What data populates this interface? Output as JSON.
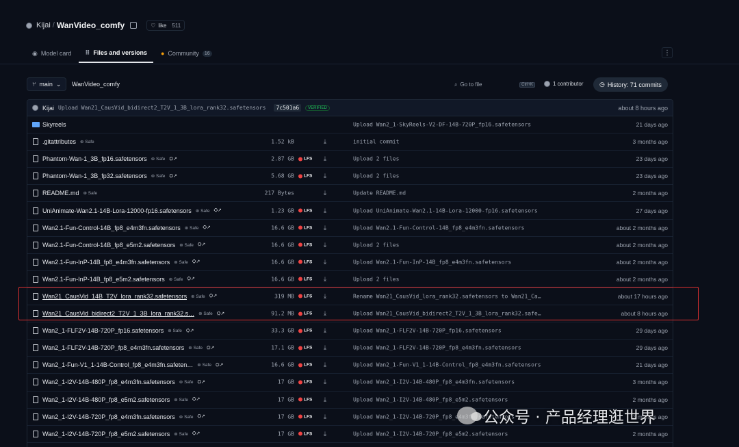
{
  "repo": {
    "owner": "Kijai",
    "separator": "/",
    "name": "WanVideo_comfy",
    "like_label": "like",
    "like_count": "511"
  },
  "tabs": [
    {
      "label": "Model card",
      "icon": "model-card-icon"
    },
    {
      "label": "Files and versions",
      "icon": "files-icon"
    },
    {
      "label": "Community",
      "icon": "community-icon",
      "count": "16"
    }
  ],
  "more_label": "⋮",
  "toolbar": {
    "branch": "main",
    "breadcrumb": "WanVideo_comfy",
    "goto_placeholder": "Go to file",
    "goto_kbd": "Ctrl+K",
    "contributors": "1 contributor",
    "history": "History: 71 commits"
  },
  "last_commit": {
    "author": "Kijai",
    "message": "Upload Wan21_CausVid_bidirect2_T2V_1_3B_lora_rank32.safetensors",
    "hash": "7c501a6",
    "verified": "VERIFIED",
    "time": "about 8 hours ago"
  },
  "files": [
    {
      "type": "folder",
      "name": "Skyreels",
      "safe": "",
      "size": "",
      "lfs": false,
      "download": false,
      "message": "Upload Wan2_1-SkyReels-V2-DF-14B-720P_fp16.safetensors",
      "time": "21 days ago"
    },
    {
      "type": "file",
      "name": ".gitattributes",
      "safe": "Safe",
      "size": "1.52 kB",
      "lfs": false,
      "download": true,
      "message": "initial commit",
      "time": "3 months ago"
    },
    {
      "type": "file",
      "name": "Phantom-Wan-1_3B_fp16.safetensors",
      "safe": "Safe",
      "size": "2.87 GB",
      "lfs": true,
      "download": true,
      "message": "Upload 2 files",
      "time": "23 days ago"
    },
    {
      "type": "file",
      "name": "Phantom-Wan-1_3B_fp32.safetensors",
      "safe": "Safe",
      "size": "5.68 GB",
      "lfs": true,
      "download": true,
      "message": "Upload 2 files",
      "time": "23 days ago"
    },
    {
      "type": "file",
      "name": "README.md",
      "safe": "Safe",
      "size": "217 Bytes",
      "lfs": false,
      "download": true,
      "message": "Update README.md",
      "time": "2 months ago"
    },
    {
      "type": "file",
      "name": "UniAnimate-Wan2.1-14B-Lora-12000-fp16.safetensors",
      "safe": "Safe",
      "size": "1.23 GB",
      "lfs": true,
      "download": true,
      "message": "Upload UniAnimate-Wan2.1-14B-Lora-12000-fp16.safetensors",
      "time": "27 days ago"
    },
    {
      "type": "file",
      "name": "Wan2.1-Fun-Control-14B_fp8_e4m3fn.safetensors",
      "safe": "Safe",
      "size": "16.6 GB",
      "lfs": true,
      "download": true,
      "message": "Upload Wan2.1-Fun-Control-14B_fp8_e4m3fn.safetensors",
      "time": "about 2 months ago"
    },
    {
      "type": "file",
      "name": "Wan2.1-Fun-Control-14B_fp8_e5m2.safetensors",
      "safe": "Safe",
      "size": "16.6 GB",
      "lfs": true,
      "download": true,
      "message": "Upload 2 files",
      "time": "about 2 months ago"
    },
    {
      "type": "file",
      "name": "Wan2.1-Fun-InP-14B_fp8_e4m3fn.safetensors",
      "safe": "Safe",
      "size": "16.6 GB",
      "lfs": true,
      "download": true,
      "message": "Upload Wan2.1-Fun-InP-14B_fp8_e4m3fn.safetensors",
      "time": "about 2 months ago"
    },
    {
      "type": "file",
      "name": "Wan2.1-Fun-InP-14B_fp8_e5m2.safetensors",
      "safe": "Safe",
      "size": "16.6 GB",
      "lfs": true,
      "download": true,
      "message": "Upload 2 files",
      "time": "about 2 months ago"
    },
    {
      "type": "file",
      "name": "Wan21_CausVid_14B_T2V_lora_rank32.safetensors",
      "safe": "Safe",
      "size": "319 MB",
      "lfs": true,
      "download": true,
      "message": "Rename Wan21_CausVid_lora_rank32.safetensors to Wan21_Ca…",
      "time": "about 17 hours ago",
      "underline": true
    },
    {
      "type": "file",
      "name": "Wan21_CausVid_bidirect2_T2V_1_3B_lora_rank32.s…",
      "safe": "Safe",
      "size": "91.2 MB",
      "lfs": true,
      "download": true,
      "message": "Upload Wan21_CausVid_bidirect2_T2V_1_3B_lora_rank32.safe…",
      "time": "about 8 hours ago",
      "underline": true
    },
    {
      "type": "file",
      "name": "Wan2_1-FLF2V-14B-720P_fp16.safetensors",
      "safe": "Safe",
      "size": "33.3 GB",
      "lfs": true,
      "download": true,
      "message": "Upload Wan2_1-FLF2V-14B-720P_fp16.safetensors",
      "time": "29 days ago"
    },
    {
      "type": "file",
      "name": "Wan2_1-FLF2V-14B-720P_fp8_e4m3fn.safetensors",
      "safe": "Safe",
      "size": "17.1 GB",
      "lfs": true,
      "download": true,
      "message": "Upload Wan2_1-FLF2V-14B-720P_fp8_e4m3fn.safetensors",
      "time": "29 days ago"
    },
    {
      "type": "file",
      "name": "Wan2_1-Fun-V1_1-14B-Control_fp8_e4m3fn.safeten…",
      "safe": "Safe",
      "size": "16.6 GB",
      "lfs": true,
      "download": true,
      "message": "Upload Wan2_1-Fun-V1_1-14B-Control_fp8_e4m3fn.safetensors",
      "time": "21 days ago"
    },
    {
      "type": "file",
      "name": "Wan2_1-I2V-14B-480P_fp8_e4m3fn.safetensors",
      "safe": "Safe",
      "size": "17 GB",
      "lfs": true,
      "download": true,
      "message": "Upload Wan2_1-I2V-14B-480P_fp8_e4m3fn.safetensors",
      "time": "3 months ago"
    },
    {
      "type": "file",
      "name": "Wan2_1-I2V-14B-480P_fp8_e5m2.safetensors",
      "safe": "Safe",
      "size": "17 GB",
      "lfs": true,
      "download": true,
      "message": "Upload Wan2_1-I2V-14B-480P_fp8_e5m2.safetensors",
      "time": "2 months ago"
    },
    {
      "type": "file",
      "name": "Wan2_1-I2V-14B-720P_fp8_e4m3fn.safetensors",
      "safe": "Safe",
      "size": "17 GB",
      "lfs": true,
      "download": true,
      "message": "Upload Wan2_1-I2V-14B-720P_fp8_e4m3fn.safetensors",
      "time": "3 months ago"
    },
    {
      "type": "file",
      "name": "Wan2_1-I2V-14B-720P_fp8_e5m2.safetensors",
      "safe": "Safe",
      "size": "17 GB",
      "lfs": true,
      "download": true,
      "message": "Upload Wan2_1-I2V-14B-720P_fp8_e5m2.safetensors",
      "time": "2 months ago"
    }
  ],
  "lfs_label": "LFS",
  "watermark": "公众号 · 产品经理逛世界",
  "colors": {
    "background": "#0b0f19",
    "lfs_red": "#ef4444",
    "highlight_red": "#e03131",
    "folder_blue": "#60a5fa"
  }
}
